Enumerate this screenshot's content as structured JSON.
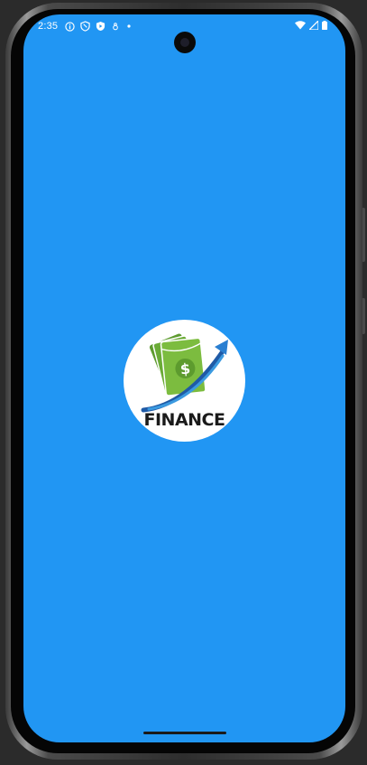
{
  "status_bar": {
    "time": "2:35",
    "icons_left": [
      "info-icon",
      "shield-icon",
      "play-protect-icon",
      "accessibility-icon",
      "dot-icon"
    ],
    "icons_right": [
      "wifi-icon",
      "signal-icon",
      "battery-icon"
    ]
  },
  "splash": {
    "logo_text": "FINANCE",
    "logo_icon": "money-growth-icon",
    "background_color": "#2196f3"
  }
}
